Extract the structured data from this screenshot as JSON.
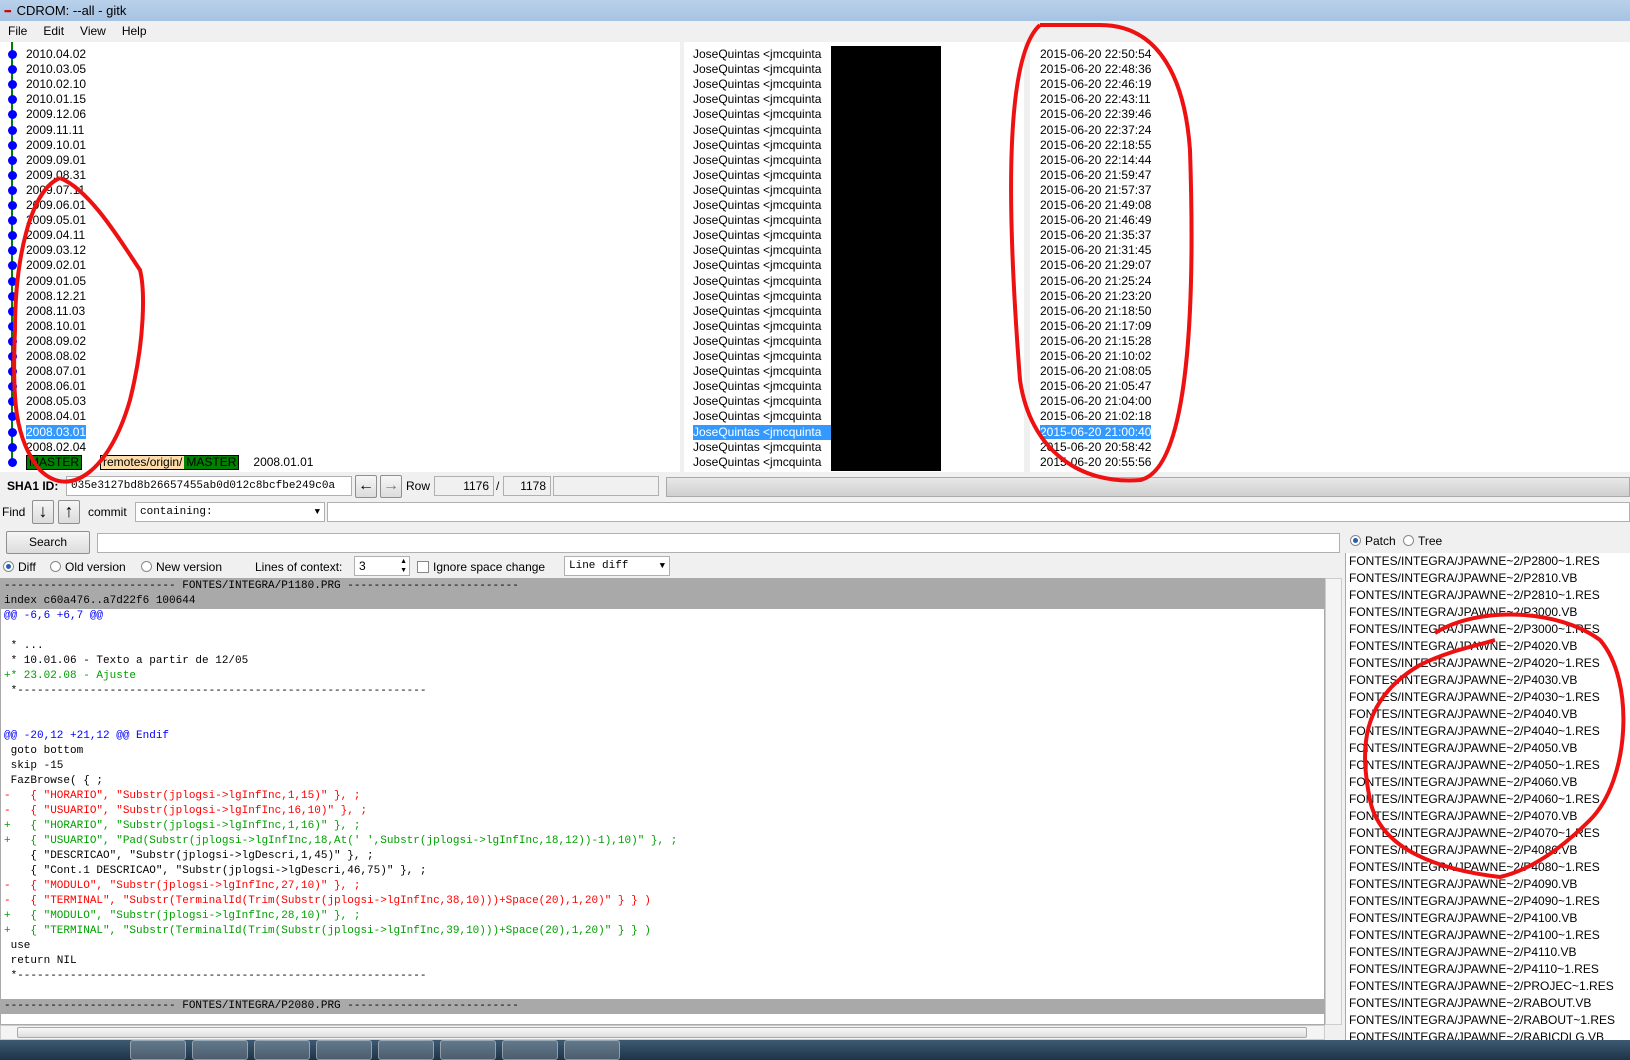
{
  "window": {
    "title": "CDROM: --all - gitk"
  },
  "menu": [
    "File",
    "Edit",
    "View",
    "Help"
  ],
  "commits": [
    {
      "subject": "2010.04.02",
      "date": "2015-06-20 22:50:54"
    },
    {
      "subject": "2010.03.05",
      "date": "2015-06-20 22:48:36"
    },
    {
      "subject": "2010.02.10",
      "date": "2015-06-20 22:46:19"
    },
    {
      "subject": "2010.01.15",
      "date": "2015-06-20 22:43:11"
    },
    {
      "subject": "2009.12.06",
      "date": "2015-06-20 22:39:46"
    },
    {
      "subject": "2009.11.11",
      "date": "2015-06-20 22:37:24"
    },
    {
      "subject": "2009.10.01",
      "date": "2015-06-20 22:18:55"
    },
    {
      "subject": "2009.09.01",
      "date": "2015-06-20 22:14:44"
    },
    {
      "subject": "2009.08.31",
      "date": "2015-06-20 21:59:47"
    },
    {
      "subject": "2009.07.11",
      "date": "2015-06-20 21:57:37"
    },
    {
      "subject": "2009.06.01",
      "date": "2015-06-20 21:49:08"
    },
    {
      "subject": "2009.05.01",
      "date": "2015-06-20 21:46:49"
    },
    {
      "subject": "2009.04.11",
      "date": "2015-06-20 21:35:37"
    },
    {
      "subject": "2009.03.12",
      "date": "2015-06-20 21:31:45"
    },
    {
      "subject": "2009.02.01",
      "date": "2015-06-20 21:29:07"
    },
    {
      "subject": "2009.01.05",
      "date": "2015-06-20 21:25:24"
    },
    {
      "subject": "2008.12.21",
      "date": "2015-06-20 21:23:20"
    },
    {
      "subject": "2008.11.03",
      "date": "2015-06-20 21:18:50"
    },
    {
      "subject": "2008.10.01",
      "date": "2015-06-20 21:17:09"
    },
    {
      "subject": "2008.09.02",
      "date": "2015-06-20 21:15:28"
    },
    {
      "subject": "2008.08.02",
      "date": "2015-06-20 21:10:02"
    },
    {
      "subject": "2008.07.01",
      "date": "2015-06-20 21:08:05"
    },
    {
      "subject": "2008.06.01",
      "date": "2015-06-20 21:05:47"
    },
    {
      "subject": "2008.05.03",
      "date": "2015-06-20 21:04:00"
    },
    {
      "subject": "2008.04.01",
      "date": "2015-06-20 21:02:18"
    },
    {
      "subject": "2008.03.01",
      "date": "2015-06-20 21:00:40",
      "selected": true
    },
    {
      "subject": "2008.02.04",
      "date": "2015-06-20 20:58:42"
    },
    {
      "subject": "2008.01.01",
      "date": "2015-06-20 20:55:56",
      "tags": [
        "MASTER",
        "remotes/origin/",
        "MASTER"
      ]
    }
  ],
  "author": "JoseQuintas <jmcquinta",
  "sha": {
    "label": "SHA1 ID:",
    "value": "035e3127bd8b26657455ab0d012c8bcfbe249c0a",
    "row_label": "Row",
    "row": "1176",
    "sep": "/",
    "total": "1178"
  },
  "find": {
    "label": "Find",
    "type": "commit",
    "mode": "containing:",
    "search_label": "Search"
  },
  "diffopts": {
    "diff": "Diff",
    "old": "Old version",
    "new": "New version",
    "context_label": "Lines of context:",
    "context": "3",
    "ignore": "Ignore space change",
    "mode": "Line diff"
  },
  "filepanel": {
    "patch": "Patch",
    "tree": "Tree"
  },
  "diff": [
    {
      "k": "h",
      "t": "-------------------------- FONTES/INTEGRA/P1180.PRG --------------------------"
    },
    {
      "k": "h",
      "t": "index c60a476..a7d22f6 100644"
    },
    {
      "k": "@",
      "t": "@@ -6,6 +6,7 @@"
    },
    {
      "k": "n",
      "t": ""
    },
    {
      "k": "n",
      "t": " * ..."
    },
    {
      "k": "n",
      "t": " * 10.01.06 - Texto a partir de 12/05"
    },
    {
      "k": "+",
      "t": "+* 23.02.08 - Ajuste"
    },
    {
      "k": "n",
      "t": " *--------------------------------------------------------------"
    },
    {
      "k": "n",
      "t": ""
    },
    {
      "k": "n",
      "t": ""
    },
    {
      "k": "@",
      "t": "@@ -20,12 +21,12 @@ Endif"
    },
    {
      "k": "n",
      "t": " goto bottom"
    },
    {
      "k": "n",
      "t": " skip -15"
    },
    {
      "k": "n",
      "t": " FazBrowse( { ;"
    },
    {
      "k": "-",
      "t": "-   { \"HORARIO\", \"Substr(jplogsi->lgInfInc,1,15)\" }, ;"
    },
    {
      "k": "-",
      "t": "-   { \"USUARIO\", \"Substr(jplogsi->lgInfInc,16,10)\" }, ;"
    },
    {
      "k": "+",
      "t": "+   { \"HORARIO\", \"Substr(jplogsi->lgInfInc,1,16)\" }, ;"
    },
    {
      "k": "+",
      "t": "+   { \"USUARIO\", \"Pad(Substr(jplogsi->lgInfInc,18,At(' ',Substr(jplogsi->lgInfInc,18,12))-1),10)\" }, ;"
    },
    {
      "k": "n",
      "t": "    { \"DESCRICAO\", \"Substr(jplogsi->lgDescri,1,45)\" }, ;"
    },
    {
      "k": "n",
      "t": "    { \"Cont.1 DESCRICAO\", \"Substr(jplogsi->lgDescri,46,75)\" }, ;"
    },
    {
      "k": "-",
      "t": "-   { \"MODULO\", \"Substr(jplogsi->lgInfInc,27,10)\" }, ;"
    },
    {
      "k": "-",
      "t": "-   { \"TERMINAL\", \"Substr(TerminalId(Trim(Substr(jplogsi->lgInfInc,38,10)))+Space(20),1,20)\" } } )"
    },
    {
      "k": "+",
      "t": "+   { \"MODULO\", \"Substr(jplogsi->lgInfInc,28,10)\" }, ;"
    },
    {
      "k": "+",
      "t": "+   { \"TERMINAL\", \"Substr(TerminalId(Trim(Substr(jplogsi->lgInfInc,39,10)))+Space(20),1,20)\" } } )"
    },
    {
      "k": "n",
      "t": " use"
    },
    {
      "k": "n",
      "t": " return NIL"
    },
    {
      "k": "n",
      "t": " *--------------------------------------------------------------"
    },
    {
      "k": "n",
      "t": ""
    },
    {
      "k": "h",
      "t": "-------------------------- FONTES/INTEGRA/P2080.PRG --------------------------"
    }
  ],
  "files": [
    "FONTES/INTEGRA/JPAWNE~2/P2800~1.RES",
    "FONTES/INTEGRA/JPAWNE~2/P2810.VB",
    "FONTES/INTEGRA/JPAWNE~2/P2810~1.RES",
    "FONTES/INTEGRA/JPAWNE~2/P3000.VB",
    "FONTES/INTEGRA/JPAWNE~2/P3000~1.RES",
    "FONTES/INTEGRA/JPAWNE~2/P4020.VB",
    "FONTES/INTEGRA/JPAWNE~2/P4020~1.RES",
    "FONTES/INTEGRA/JPAWNE~2/P4030.VB",
    "FONTES/INTEGRA/JPAWNE~2/P4030~1.RES",
    "FONTES/INTEGRA/JPAWNE~2/P4040.VB",
    "FONTES/INTEGRA/JPAWNE~2/P4040~1.RES",
    "FONTES/INTEGRA/JPAWNE~2/P4050.VB",
    "FONTES/INTEGRA/JPAWNE~2/P4050~1.RES",
    "FONTES/INTEGRA/JPAWNE~2/P4060.VB",
    "FONTES/INTEGRA/JPAWNE~2/P4060~1.RES",
    "FONTES/INTEGRA/JPAWNE~2/P4070.VB",
    "FONTES/INTEGRA/JPAWNE~2/P4070~1.RES",
    "FONTES/INTEGRA/JPAWNE~2/P4080.VB",
    "FONTES/INTEGRA/JPAWNE~2/P4080~1.RES",
    "FONTES/INTEGRA/JPAWNE~2/P4090.VB",
    "FONTES/INTEGRA/JPAWNE~2/P4090~1.RES",
    "FONTES/INTEGRA/JPAWNE~2/P4100.VB",
    "FONTES/INTEGRA/JPAWNE~2/P4100~1.RES",
    "FONTES/INTEGRA/JPAWNE~2/P4110.VB",
    "FONTES/INTEGRA/JPAWNE~2/P4110~1.RES",
    "FONTES/INTEGRA/JPAWNE~2/PROJEC~1.RES",
    "FONTES/INTEGRA/JPAWNE~2/RABOUT.VB",
    "FONTES/INTEGRA/JPAWNE~2/RABOUT~1.RES",
    "FONTES/INTEGRA/JPAWNE~2/RABICDLG.VB"
  ],
  "colors": {
    "add": "#00a000",
    "del": "#ff0000",
    "hunk": "#0000ff",
    "header_bg": "#a9a9a9",
    "selection": "#3399ff",
    "tag_head": "#008000",
    "tag_remote": "#ffddaa",
    "annotation": "#ee1111"
  }
}
